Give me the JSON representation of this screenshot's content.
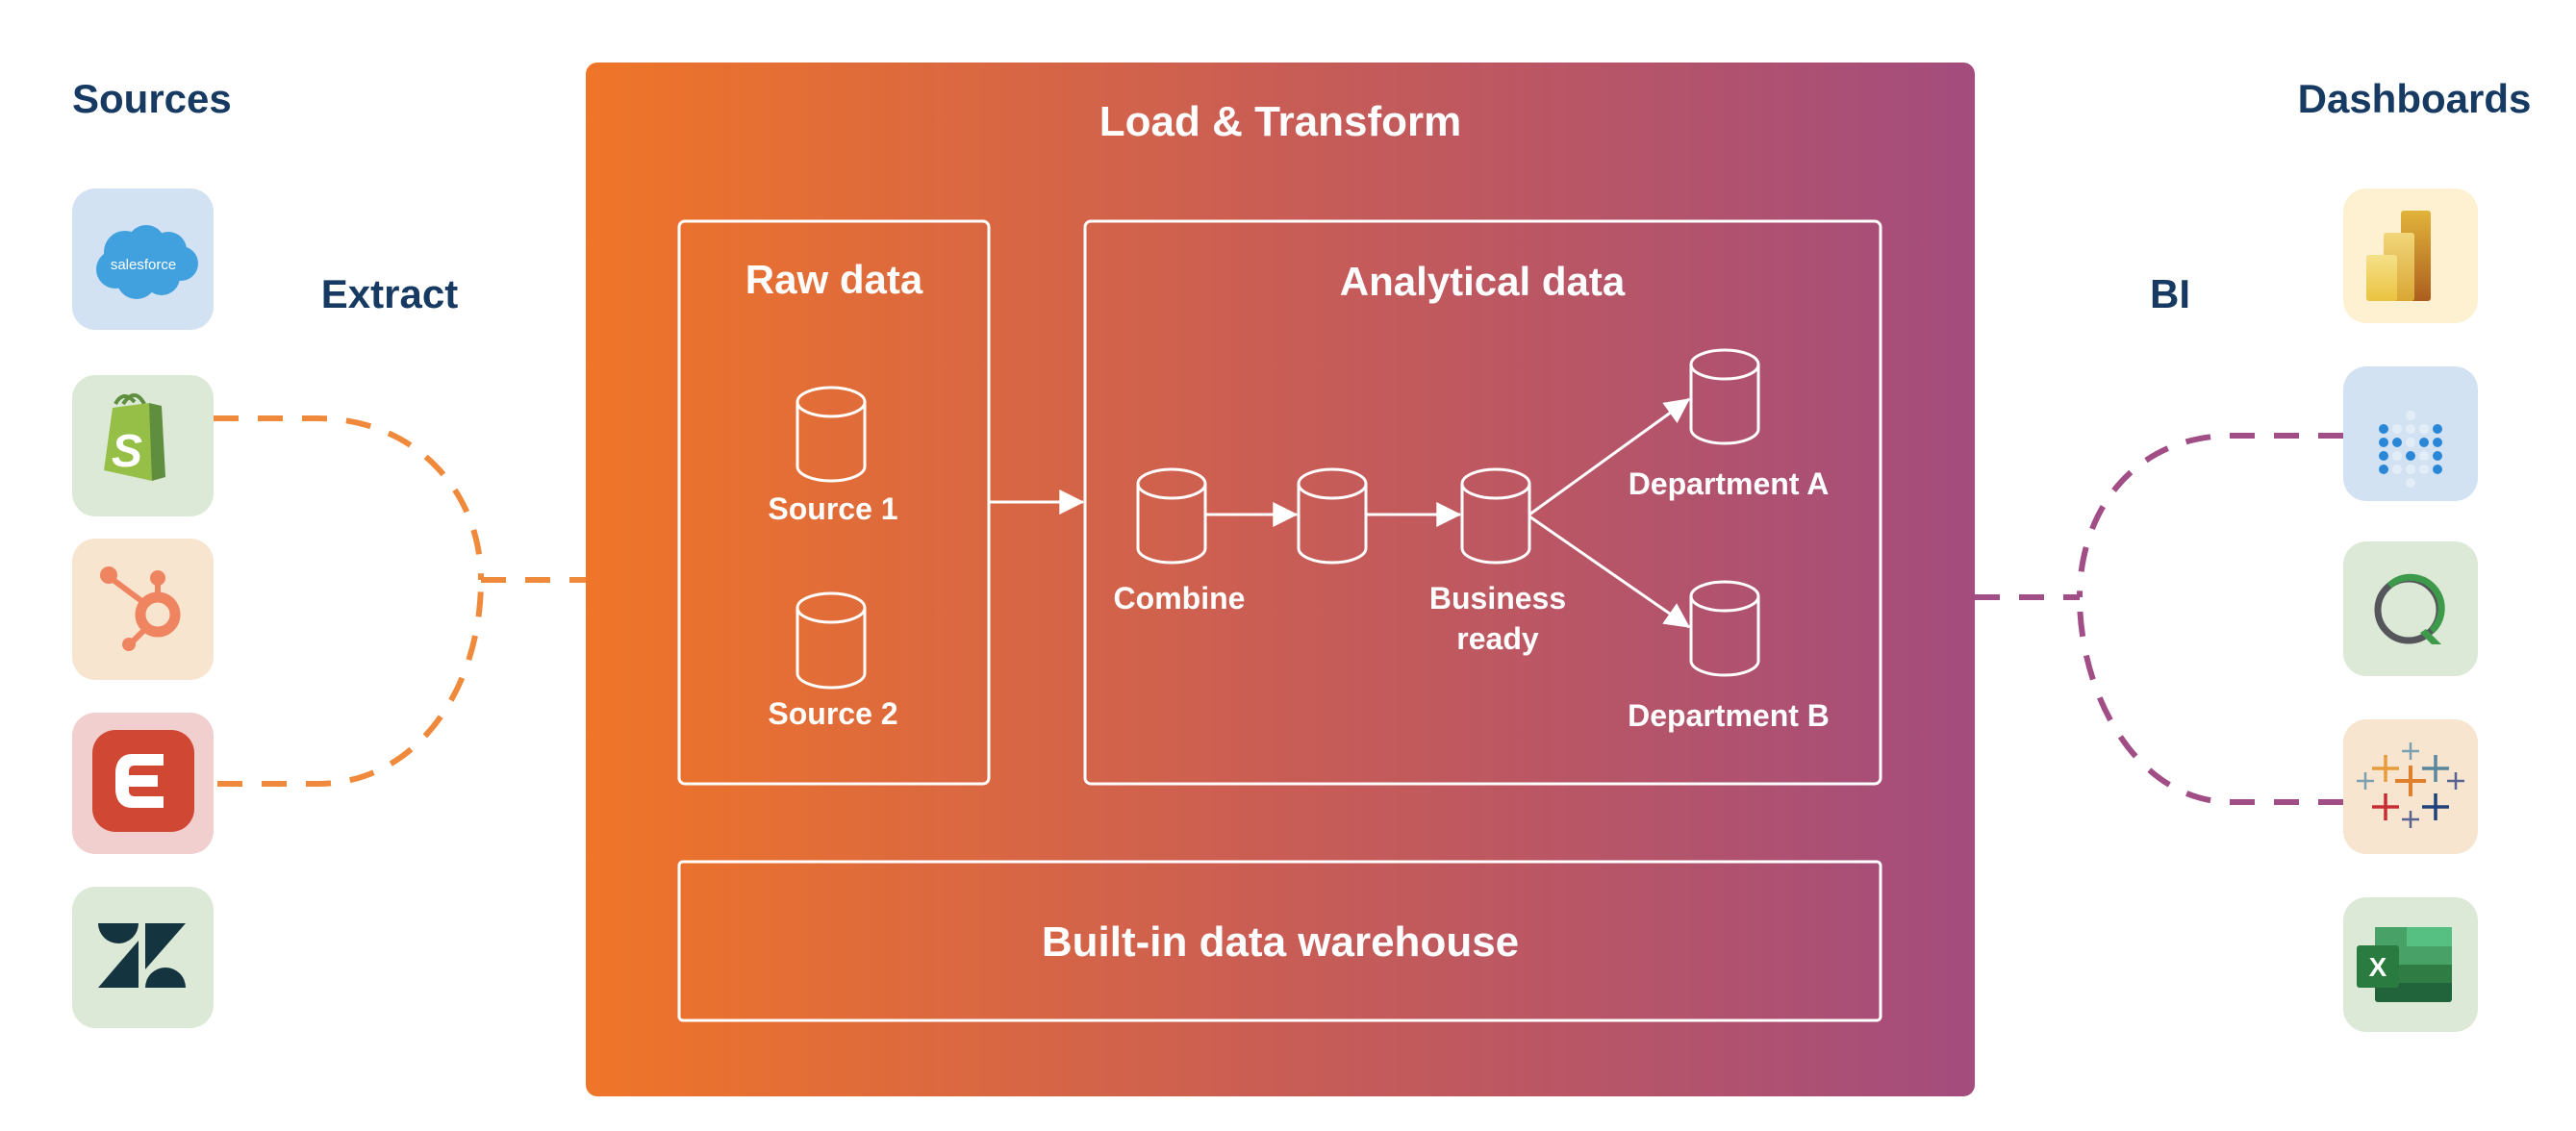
{
  "sources": {
    "title": "Sources",
    "items": [
      {
        "name": "Salesforce",
        "icon": "salesforce-icon",
        "wordmark": "salesforce",
        "bg": "#d3e2f3"
      },
      {
        "name": "Shopify",
        "icon": "shopify-icon",
        "glyph": "S",
        "bg": "#dde9d7"
      },
      {
        "name": "HubSpot",
        "icon": "hubspot-icon",
        "bg": "#f8e5cf"
      },
      {
        "name": "Eventbrite",
        "icon": "eventbrite-icon",
        "bg": "#f1cfcf"
      },
      {
        "name": "Zendesk",
        "icon": "zendesk-icon",
        "bg": "#dde9d7"
      }
    ]
  },
  "extract_label": "Extract",
  "bi_label": "BI",
  "main": {
    "title": "Load & Transform",
    "gradient": {
      "start": "#ef7528",
      "end": "#a34c7d"
    },
    "raw": {
      "title": "Raw data",
      "items": [
        "Source 1",
        "Source 2"
      ]
    },
    "analytical": {
      "title": "Analytical data",
      "nodes": {
        "combine": "Combine",
        "business_line1": "Business",
        "business_line2": "ready",
        "dept_a": "Department A",
        "dept_b": "Department B"
      }
    },
    "warehouse": "Built-in data warehouse"
  },
  "dashboards": {
    "title": "Dashboards",
    "items": [
      {
        "name": "Power BI",
        "icon": "power-bi-icon",
        "bg": "#fdf1d2"
      },
      {
        "name": "Metabase",
        "icon": "metabase-icon",
        "bg": "#d3e2f3"
      },
      {
        "name": "Qlik",
        "icon": "qlik-icon",
        "bg": "#dde9d7"
      },
      {
        "name": "Tableau",
        "icon": "tableau-icon",
        "bg": "#f8e5cf"
      },
      {
        "name": "Excel",
        "icon": "excel-icon",
        "glyph": "X",
        "bg": "#dde9d7"
      }
    ]
  },
  "colors": {
    "heading": "#173a63",
    "extract_line": "#ef8a3c",
    "bi_line": "#a14d86"
  }
}
